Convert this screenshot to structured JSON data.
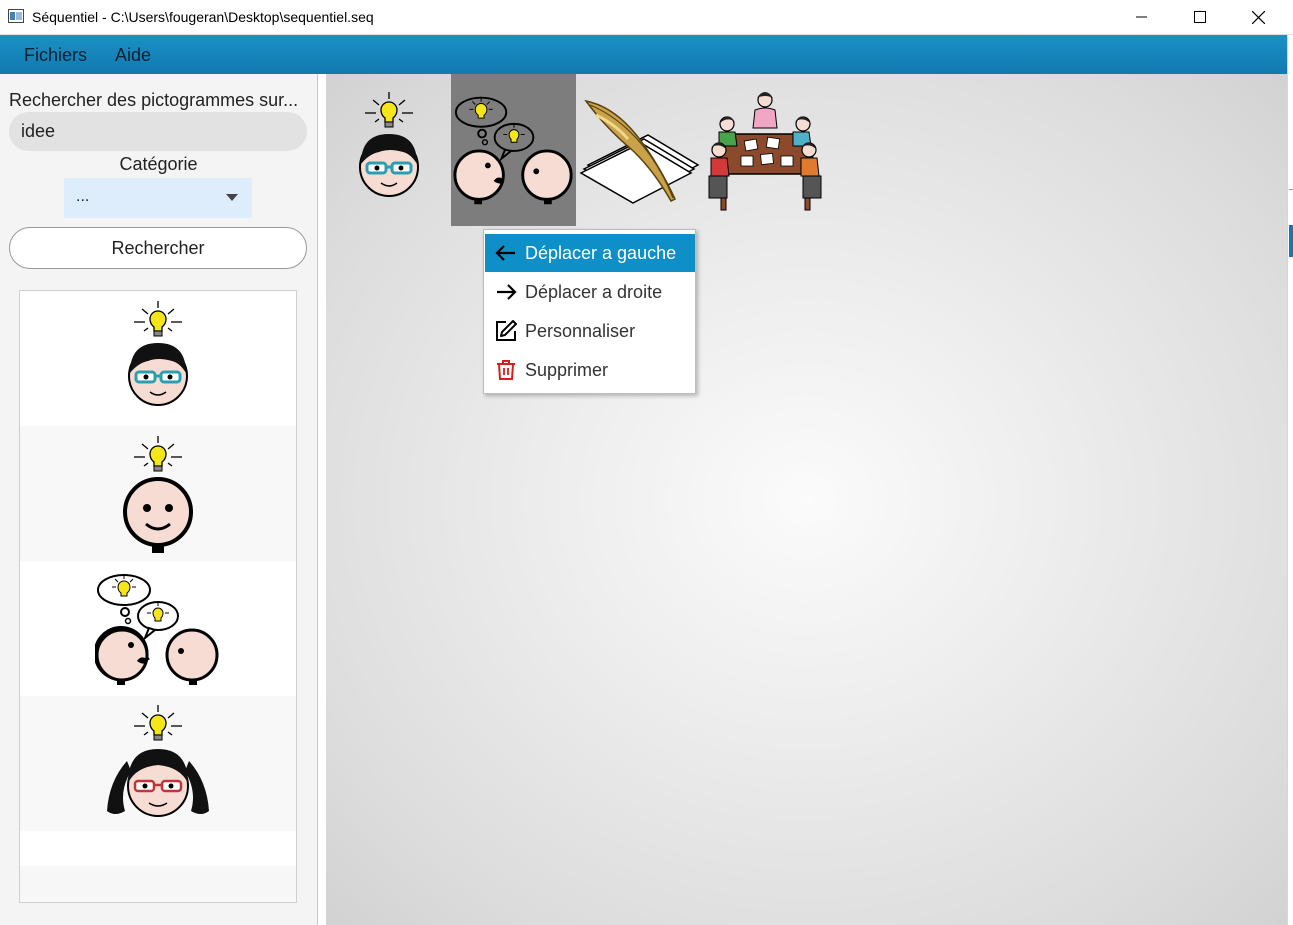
{
  "window": {
    "title": "Séquentiel - C:\\Users\\fougeran\\Desktop\\sequentiel.seq"
  },
  "menu": {
    "fichiers": "Fichiers",
    "aide": "Aide"
  },
  "sidebar": {
    "search_label": "Rechercher des pictogrammes sur...",
    "search_value": "idee",
    "category_label": "Catégorie",
    "category_value": "...",
    "search_button": "Rechercher",
    "results": [
      {
        "icon": "idea-boy-glasses-icon"
      },
      {
        "icon": "idea-face-icon"
      },
      {
        "icon": "idea-conversation-icon"
      },
      {
        "icon": "idea-girl-glasses-icon"
      }
    ]
  },
  "sequence": [
    {
      "icon": "idea-boy-glasses-icon",
      "selected": false
    },
    {
      "icon": "idea-conversation-icon",
      "selected": true
    },
    {
      "icon": "quill-paper-icon",
      "selected": false
    },
    {
      "icon": "meeting-table-icon",
      "selected": false
    }
  ],
  "context_menu": {
    "items": [
      {
        "label": "Déplacer a gauche",
        "icon": "arrow-left-icon",
        "active": true
      },
      {
        "label": "Déplacer a droite",
        "icon": "arrow-right-icon",
        "active": false
      },
      {
        "label": "Personnaliser",
        "icon": "edit-icon",
        "active": false
      },
      {
        "label": "Supprimer",
        "icon": "trash-icon",
        "active": false
      }
    ]
  },
  "colors": {
    "menubar": "#1a91c4",
    "menu_active": "#0f8fc8",
    "delete_icon": "#d21f1f",
    "bulb": "#f5e61a"
  }
}
